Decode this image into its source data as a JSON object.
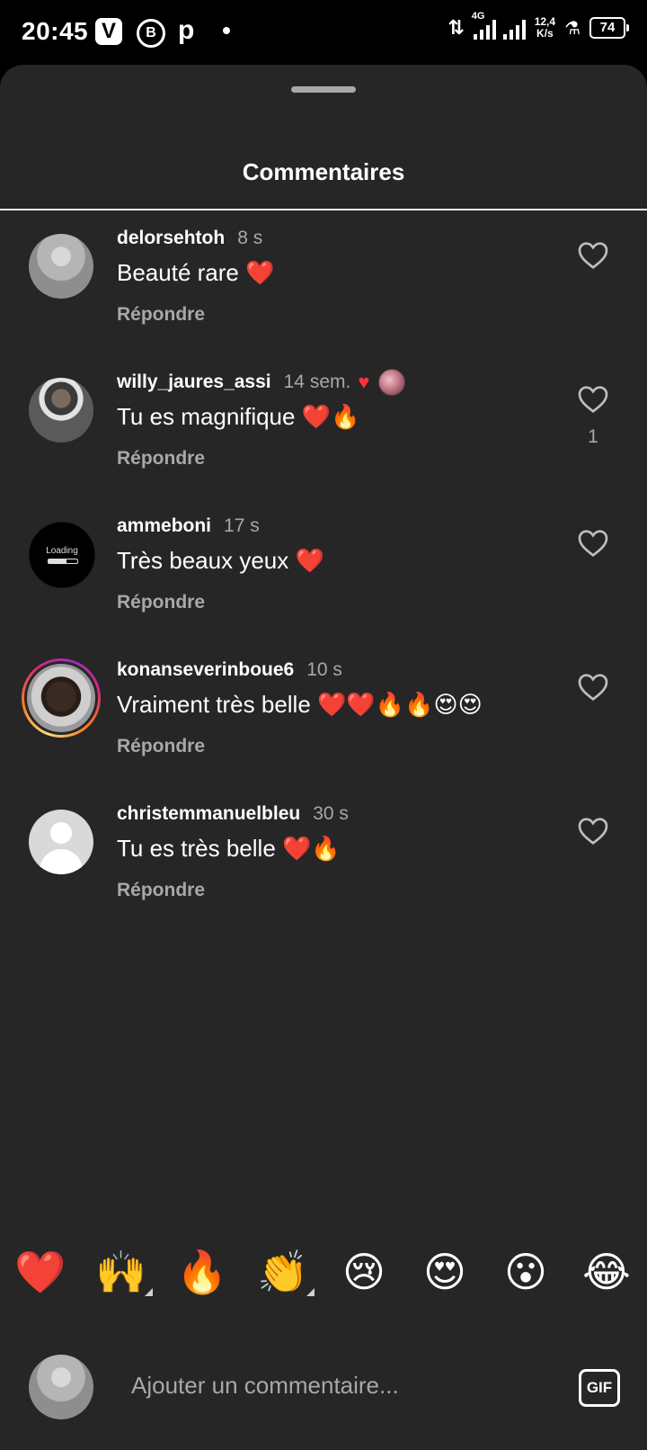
{
  "status_bar": {
    "time": "20:45",
    "v_label": "V",
    "b_label": "B",
    "p_label": "p",
    "network": "4G",
    "speed_value": "12,4",
    "speed_unit": "K/s",
    "battery": "74"
  },
  "sheet": {
    "title": "Commentaires"
  },
  "comments": [
    {
      "username": "delorsehtoh",
      "time": "8 s",
      "text": "Beauté rare ❤️",
      "reply_label": "Répondre"
    },
    {
      "username": "willy_jaures_assi",
      "time": "14 sem.",
      "text": "Tu es magnifique ❤️🔥",
      "reply_label": "Répondre",
      "likes": "1"
    },
    {
      "username": "ammeboni",
      "time": "17 s",
      "text": "Très beaux yeux ❤️",
      "reply_label": "Répondre",
      "avatar_text": "Loading"
    },
    {
      "username": "konanseverinboue6",
      "time": "10 s",
      "text": "Vraiment très belle ❤️❤️🔥🔥😍😍",
      "reply_label": "Répondre"
    },
    {
      "username": "christemmanuelbleu",
      "time": "30 s",
      "text": "Tu es très belle ❤️🔥",
      "reply_label": "Répondre"
    }
  ],
  "emoji_bar": [
    "❤️",
    "🙌",
    "🔥",
    "👏",
    "😢",
    "😍",
    "😮",
    "😂"
  ],
  "composer": {
    "placeholder": "Ajouter un commentaire...",
    "gif_label": "GIF"
  },
  "colors": {
    "sheet_bg": "#262626",
    "secondary_text": "#a8a8a8",
    "like_red": "#ff3040"
  }
}
